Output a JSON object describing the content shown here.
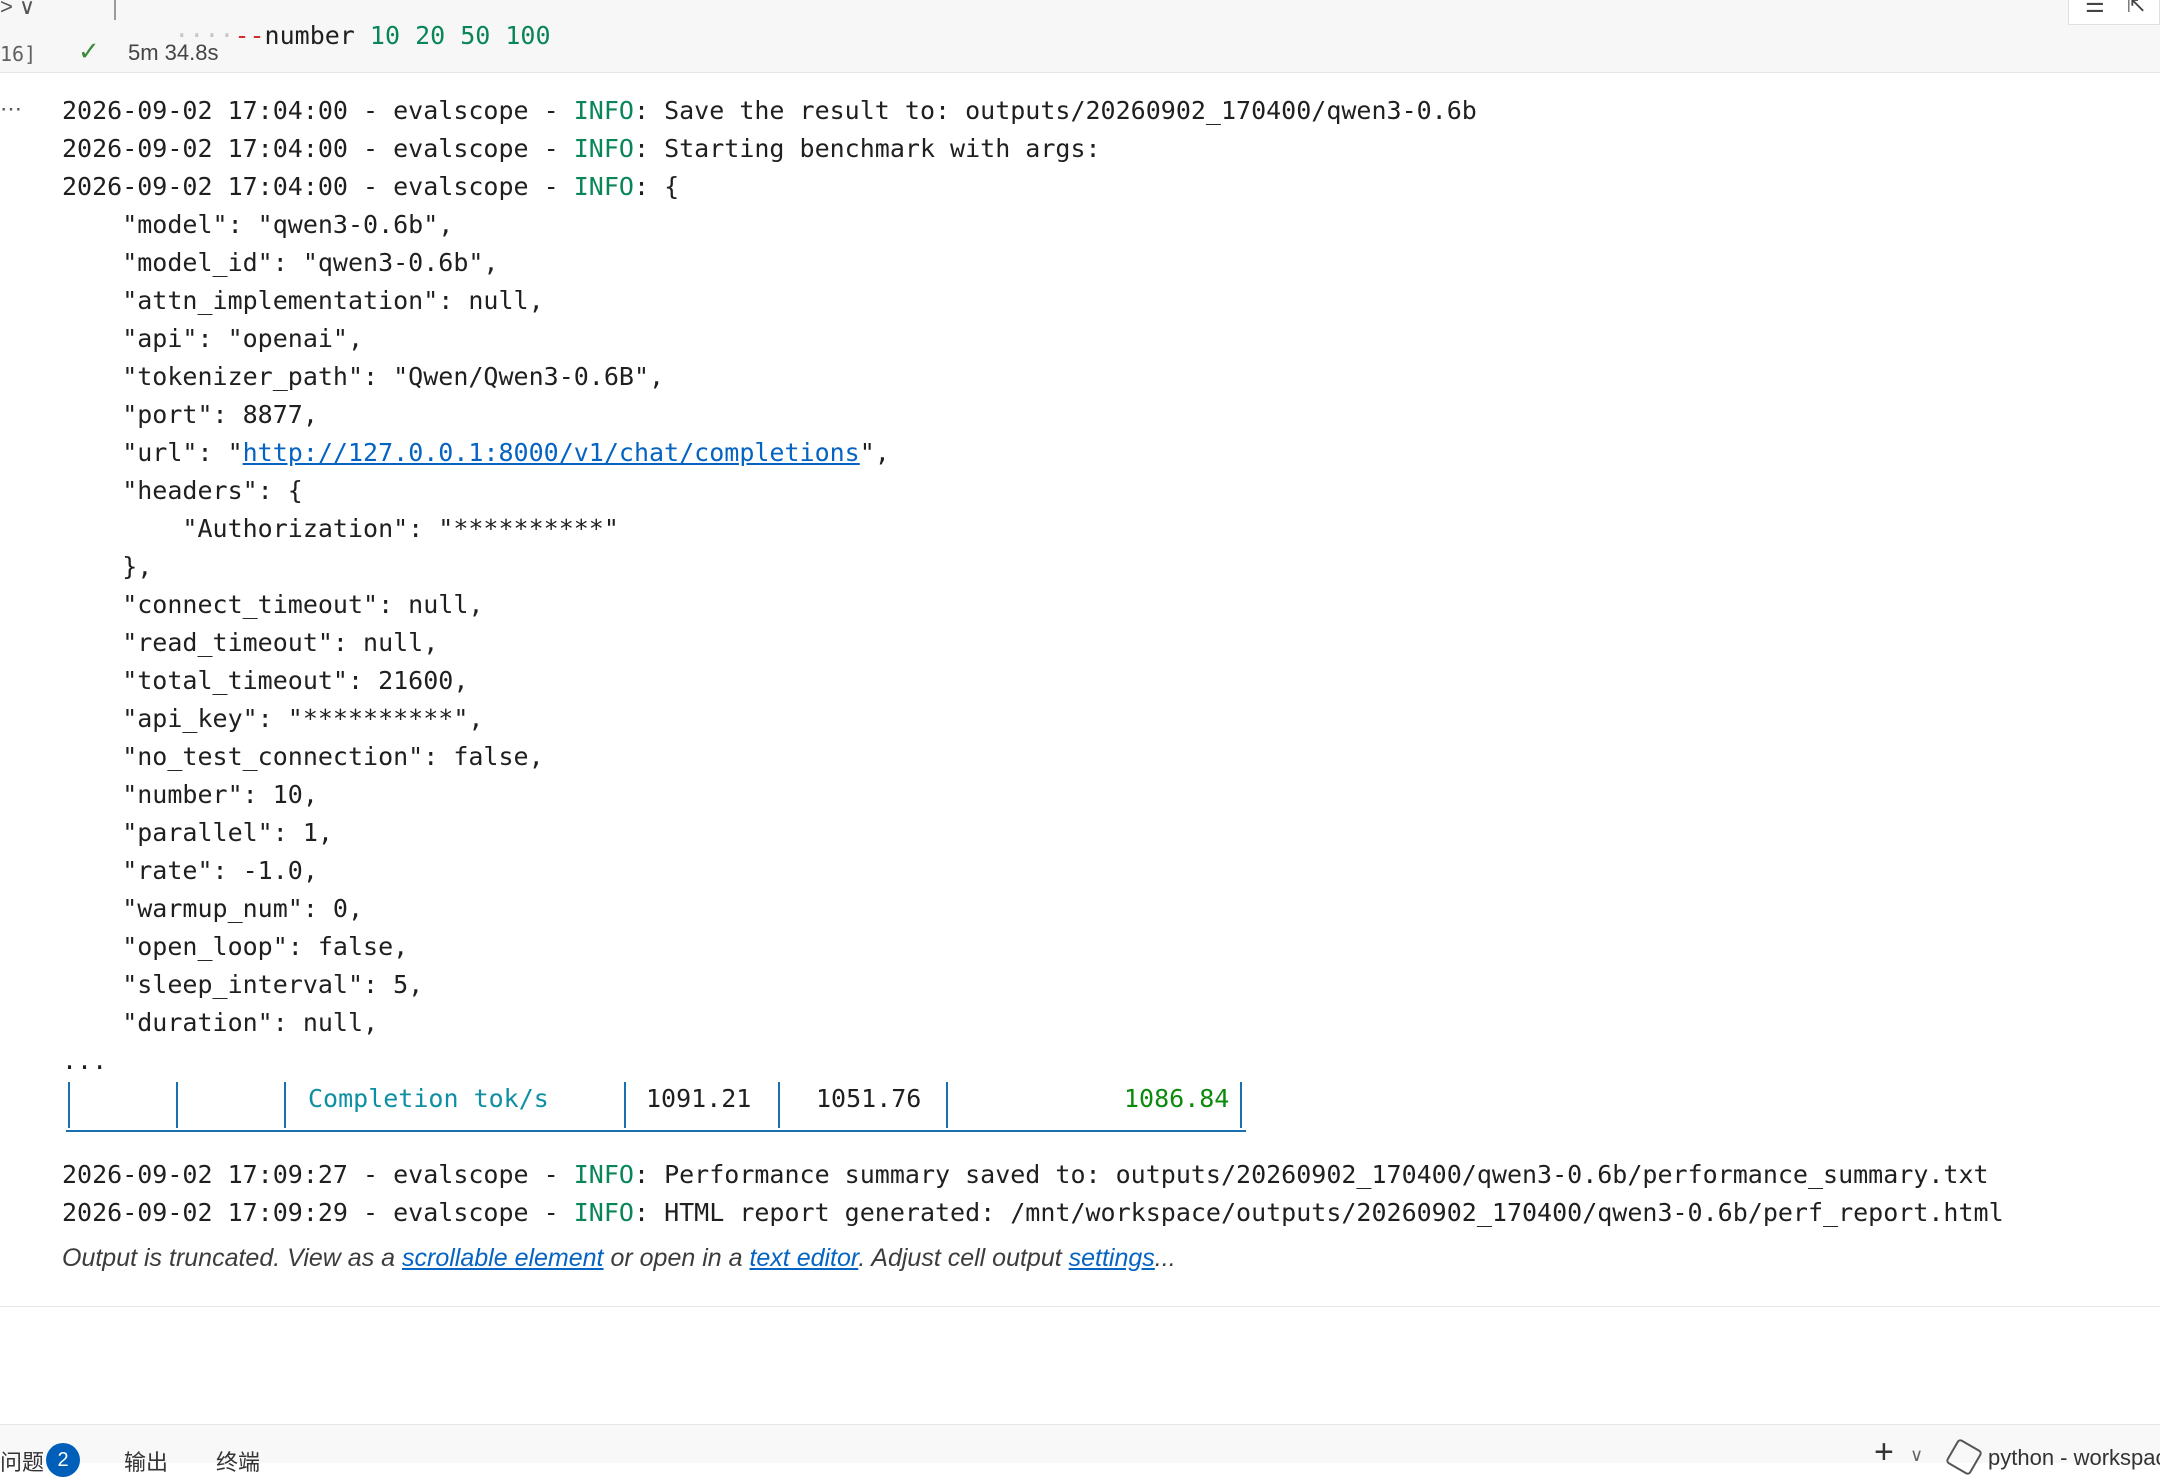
{
  "cell": {
    "gutter_chevron": "> ∨",
    "execution_count": "16]",
    "code_line": {
      "indent": "····",
      "dashes": "--",
      "flag": "number",
      "values": "10 20 50 100"
    },
    "status_check": "✓",
    "duration": "5m 34.8s",
    "toolbar_icons": [
      "list-icon",
      "open-external-icon"
    ]
  },
  "output": {
    "more_indicator": "...",
    "log_lines": [
      {
        "prefix": "2026-09-02 17:04:00 - evalscope - ",
        "level": "INFO",
        "message": ": Save the result to: outputs/20260902_170400/qwen3-0.6b"
      },
      {
        "prefix": "2026-09-02 17:04:00 - evalscope - ",
        "level": "INFO",
        "message": ": Starting benchmark with args:"
      },
      {
        "prefix": "2026-09-02 17:04:00 - evalscope - ",
        "level": "INFO",
        "message": ": {"
      }
    ],
    "args_lines": [
      "    \"model\": \"qwen3-0.6b\",",
      "    \"model_id\": \"qwen3-0.6b\",",
      "    \"attn_implementation\": null,",
      "    \"api\": \"openai\",",
      "    \"tokenizer_path\": \"Qwen/Qwen3-0.6B\",",
      "    \"port\": 8877,"
    ],
    "url_line": {
      "before": "    \"url\": \"",
      "link": "http://127.0.0.1:8000/v1/chat/completions",
      "after": "\","
    },
    "args_lines_2": [
      "    \"headers\": {",
      "        \"Authorization\": \"**********\"",
      "    },",
      "    \"connect_timeout\": null,",
      "    \"read_timeout\": null,",
      "    \"total_timeout\": 21600,",
      "    \"api_key\": \"**********\",",
      "    \"no_test_connection\": false,",
      "    \"number\": 10,",
      "    \"parallel\": 1,",
      "    \"rate\": -1.0,",
      "    \"warmup_num\": 0,",
      "    \"open_loop\": false,",
      "    \"sleep_interval\": 5,",
      "    \"duration\": null,"
    ],
    "ellipsis": "...",
    "table_row": {
      "metric": "Completion tok/s",
      "v1": "1091.21",
      "v2": "1051.76",
      "v3": "1086.84"
    },
    "final_lines": [
      {
        "prefix": "2026-09-02 17:09:27 - evalscope - ",
        "level": "INFO",
        "message": ": Performance summary saved to: outputs/20260902_170400/qwen3-0.6b/performance_summary.txt"
      },
      {
        "prefix": "2026-09-02 17:09:29 - evalscope - ",
        "level": "INFO",
        "message": ": HTML report generated: /mnt/workspace/outputs/20260902_170400/qwen3-0.6b/perf_report.html"
      }
    ],
    "truncation": {
      "t1": "Output is truncated. View as a ",
      "link1": "scrollable element",
      "t2": " or open in a ",
      "link2": "text editor",
      "t3": ". Adjust cell output ",
      "link3": "settings",
      "t4": "..."
    }
  },
  "panel": {
    "problems_label": "问题",
    "problems_count": "2",
    "output_label": "输出",
    "terminal_label": "终端",
    "add_label": "+",
    "add_caret": "∨",
    "kernel_label": "python - workspace"
  },
  "colors": {
    "info": "#098658",
    "link": "#0563c1",
    "table_border": "#1a6fb0",
    "metric": "#0e8fa3",
    "highlight": "#0b8a0b",
    "badge": "#005fb8"
  }
}
